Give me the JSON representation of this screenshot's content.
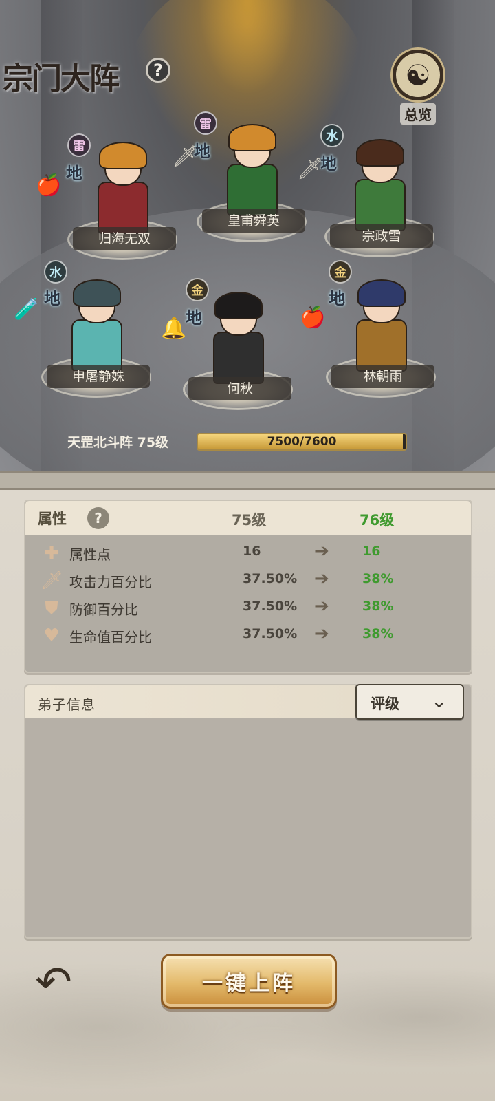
{
  "header": {
    "title": "宗门大阵",
    "help_icon": "question-icon",
    "overview_label": "总览",
    "overview_icon": "yin-yang-icon"
  },
  "heroes": [
    {
      "name": "归海无双",
      "element": "雷",
      "terrain": "地",
      "robe_color": "#8c2b2e",
      "hair_color": "#d18a2d",
      "item": "gourd"
    },
    {
      "name": "皇甫舜英",
      "element": "雷",
      "terrain": "地",
      "robe_color": "#2f6e34",
      "hair_color": "#d18a2d",
      "item": "sword"
    },
    {
      "name": "宗政雪",
      "element": "水",
      "terrain": "地",
      "robe_color": "#3e7a3b",
      "hair_color": "#4a2b1c",
      "item": "sword"
    },
    {
      "name": "申屠静姝",
      "element": "水",
      "terrain": "地",
      "robe_color": "#5bb4b0",
      "hair_color": "#3e5257",
      "item": "gourd"
    },
    {
      "name": "何秋",
      "element": "金",
      "terrain": "地",
      "robe_color": "#2f2f2f",
      "hair_color": "#1d1b1b",
      "item": "bell"
    },
    {
      "name": "林朝雨",
      "element": "金",
      "terrain": "地",
      "robe_color": "#a0702a",
      "hair_color": "#2f3a6a",
      "item": "gourd"
    }
  ],
  "formation": {
    "label": "天罡北斗阵 75级",
    "progress_text": "7500/7600",
    "progress": 0.987
  },
  "attributes": {
    "title": "属性",
    "current_level": "75级",
    "next_level": "76级",
    "rows": [
      {
        "label": "属性点",
        "current": "16",
        "next": "16",
        "icon": "plus-icon"
      },
      {
        "label": "攻击力百分比",
        "current": "37.50%",
        "next": "38%",
        "icon": "sword-icon"
      },
      {
        "label": "防御百分比",
        "current": "37.50%",
        "next": "38%",
        "icon": "shield-icon"
      },
      {
        "label": "生命值百分比",
        "current": "37.50%",
        "next": "38%",
        "icon": "heart-icon"
      }
    ]
  },
  "disciples": {
    "title": "弟子信息",
    "sort_value": "评级"
  },
  "buttons": {
    "back_icon": "back-arrow-icon",
    "deploy_label": "一键上阵"
  },
  "colors": {
    "accent_green": "#3f9a2f",
    "gold": "#c79937"
  }
}
